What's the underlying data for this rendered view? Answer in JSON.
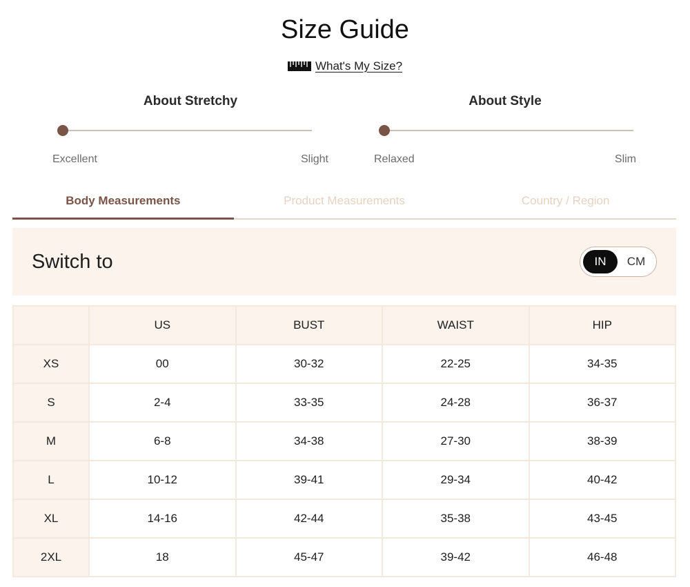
{
  "page": {
    "title": "Size Guide"
  },
  "what_my_size": {
    "icon": "ruler-icon",
    "label": "What's My Size?"
  },
  "scales": {
    "stretchy": {
      "title": "About Stretchy",
      "min_label": "Excellent",
      "max_label": "Slight",
      "value": 0
    },
    "style": {
      "title": "About Style",
      "min_label": "Relaxed",
      "max_label": "Slim",
      "value": 0
    }
  },
  "tabs": [
    {
      "label": "Body Measurements",
      "active": true
    },
    {
      "label": "Product Measurements",
      "active": false
    },
    {
      "label": "Country / Region",
      "active": false
    }
  ],
  "unit_switch": {
    "label": "Switch to",
    "options": [
      "IN",
      "CM"
    ],
    "selected": "IN"
  },
  "table": {
    "headers": [
      "",
      "US",
      "BUST",
      "WAIST",
      "HIP"
    ],
    "rows": [
      [
        "XS",
        "00",
        "30-32",
        "22-25",
        "34-35"
      ],
      [
        "S",
        "2-4",
        "33-35",
        "24-28",
        "36-37"
      ],
      [
        "M",
        "6-8",
        "34-38",
        "27-30",
        "38-39"
      ],
      [
        "L",
        "10-12",
        "39-41",
        "29-34",
        "40-42"
      ],
      [
        "XL",
        "14-16",
        "42-44",
        "35-38",
        "43-45"
      ],
      [
        "2XL",
        "18",
        "45-47",
        "39-42",
        "46-48"
      ]
    ]
  },
  "colors": {
    "accent": "#7a5447",
    "panel_bg": "#fbf3ec",
    "inactive_tab": "#e6d2c0",
    "toggle_active": "#0d0d0d"
  }
}
